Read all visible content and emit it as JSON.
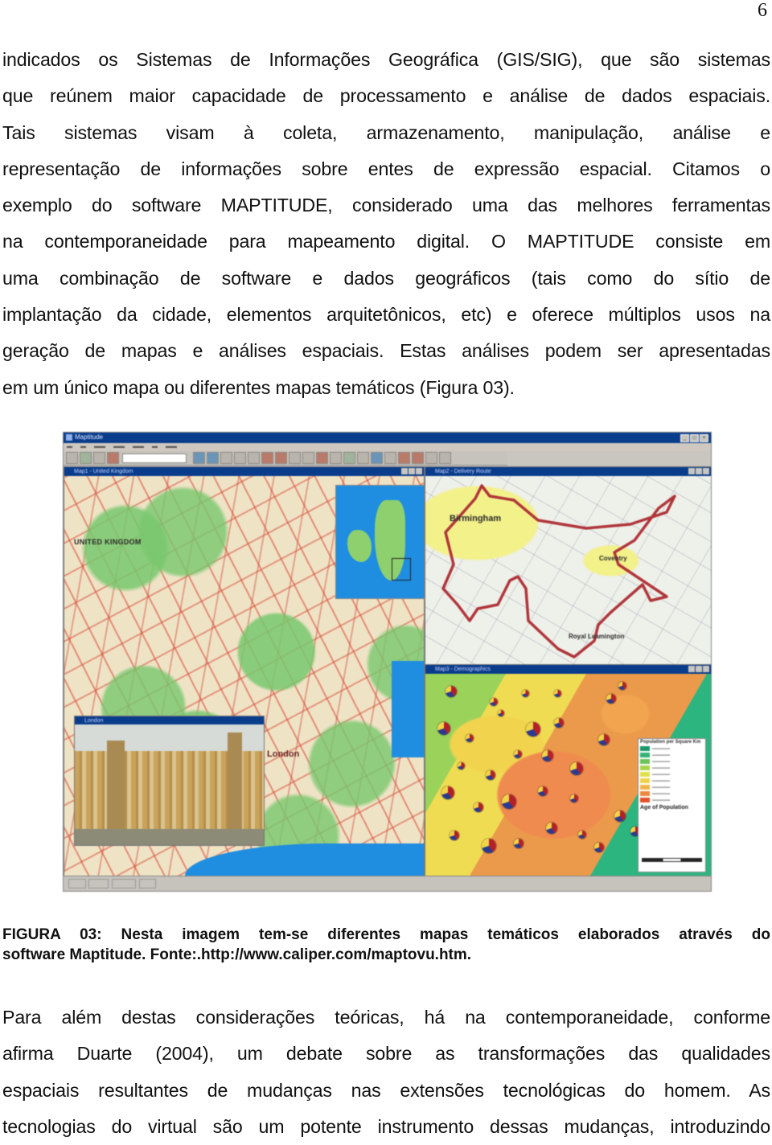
{
  "page_number": "6",
  "paragraph1": {
    "lines": [
      "indicados os Sistemas de Informações Geográfica (GIS/SIG), que são sistemas",
      "que reúnem maior capacidade de processamento e análise de dados espaciais.",
      "Tais sistemas visam à coleta, armazenamento, manipulação, análise e",
      "representação de informações sobre entes de expressão espacial. Citamos o",
      "exemplo do software MAPTITUDE, considerado uma das melhores ferramentas",
      "na contemporaneidade para mapeamento digital. O MAPTITUDE consiste em",
      "uma combinação de software e dados geográficos (tais como do sítio de",
      "implantação da cidade, elementos arquitetônicos, etc) e oferece múltiplos usos na",
      "geração de mapas e análises espaciais. Estas análises podem ser apresentadas",
      "em um único mapa ou diferentes mapas temáticos (Figura 03)."
    ]
  },
  "figure": {
    "app_window": {
      "title": "Maptitude",
      "panes": {
        "uk_map": {
          "title": "Map1 - United Kingdom",
          "labels": {
            "country": "UNITED KINGDOM",
            "city": "London"
          }
        },
        "photo_window": {
          "title": "London"
        },
        "route_map": {
          "title": "Map2 - Delivery Route",
          "labels": {
            "city1": "Birmingham",
            "city2": "Coventry",
            "city3": "Royal Leamington"
          }
        },
        "demographics_map": {
          "title": "Map3 - Demographics",
          "legend": {
            "title": "Population per Square Km",
            "subtitle": "Age of Population",
            "swatch_colors": [
              "#1a9a6a",
              "#34b277",
              "#6cc45a",
              "#a8d44a",
              "#e0e04a",
              "#f0d24a",
              "#f0b44a",
              "#ee8a3e",
              "#e2502c"
            ]
          }
        }
      }
    },
    "caption": {
      "lines": [
        "FIGURA 03: Nesta imagem tem-se diferentes mapas temáticos elaborados através do",
        "software Maptitude. Fonte:.http://www.caliper.com/maptovu.htm."
      ]
    }
  },
  "paragraph2": {
    "lines": [
      "Para além destas considerações teóricas, há na contemporaneidade, conforme",
      "afirma Duarte (2004), um debate sobre as transformações das qualidades",
      "espaciais resultantes de mudanças nas extensões tecnológicas do homem. As",
      "tecnologias do virtual são um potente instrumento dessas mudanças, introduzindo"
    ]
  }
}
